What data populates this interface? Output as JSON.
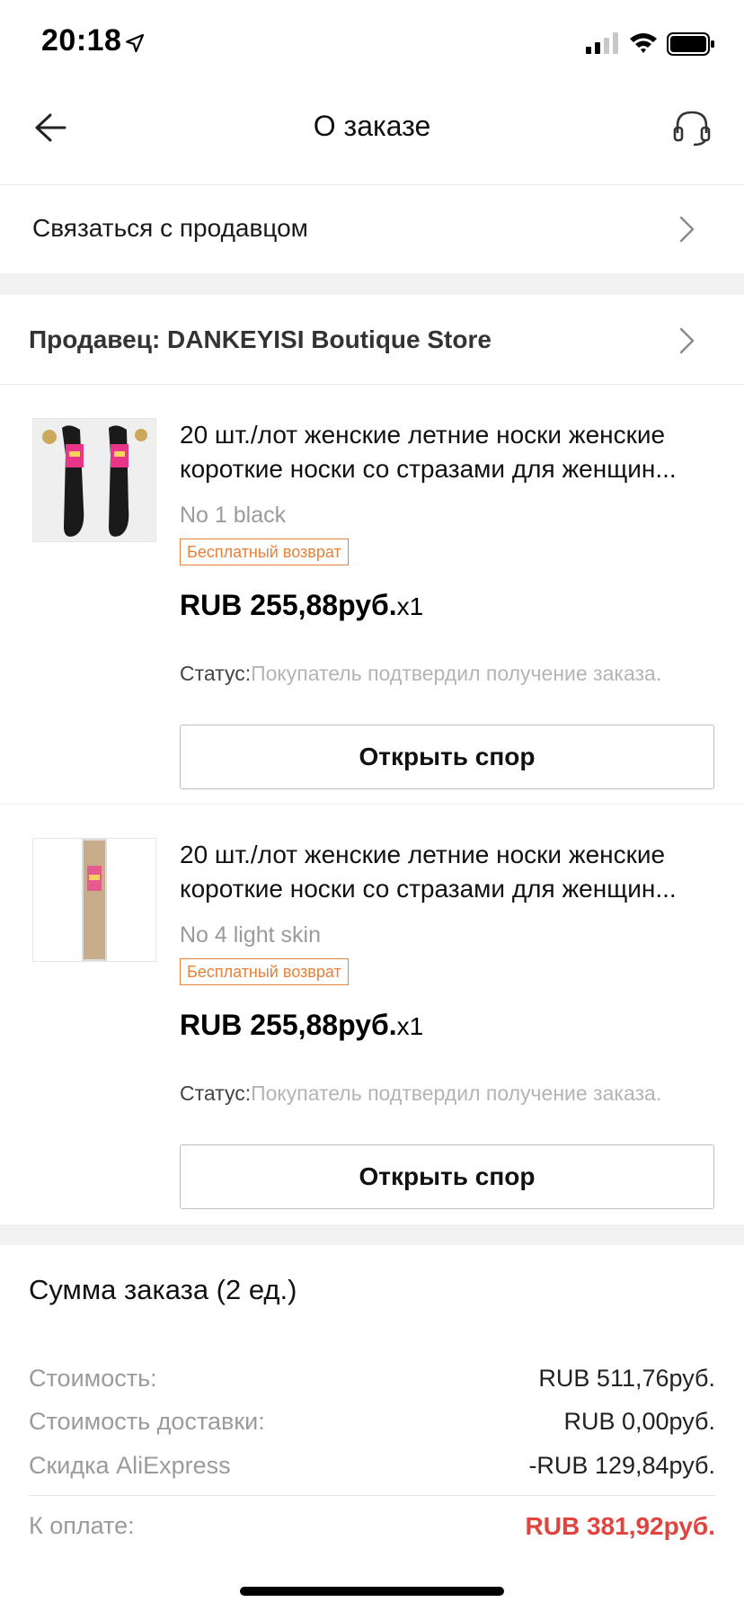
{
  "status_bar": {
    "time": "20:18",
    "icons": [
      "location-arrow-icon",
      "cellular-signal-icon",
      "wifi-icon",
      "battery-icon"
    ]
  },
  "nav": {
    "title": "О заказе",
    "back_icon": "arrow-left-icon",
    "support_icon": "headset-icon"
  },
  "contact_seller": {
    "label": "Связаться с продавцом"
  },
  "seller": {
    "label": "Продавец: DANKEYISI Boutique Store"
  },
  "items": [
    {
      "title_line1": "20 шт./лот женские летние носки женские",
      "title_line2": "короткие носки со стразами для женщин...",
      "variant": "No 1 black",
      "badge": "Бесплатный возврат",
      "price": "RUB 255,88руб.",
      "qty": "x1",
      "status_label": "Статус:",
      "status_value": "Покупатель подтвердил получение заказа.",
      "dispute_label": "Открыть спор"
    },
    {
      "title_line1": "20 шт./лот женские летние носки женские",
      "title_line2": "короткие носки со стразами для женщин...",
      "variant": "No 4 light skin",
      "badge": "Бесплатный возврат",
      "price": "RUB 255,88руб.",
      "qty": "x1",
      "status_label": "Статус:",
      "status_value": "Покупатель подтвердил получение заказа.",
      "dispute_label": "Открыть спор"
    }
  ],
  "summary": {
    "heading": "Сумма заказа (2 ед.)",
    "cost_label": "Стоимость:",
    "cost_value": "RUB 511,76руб.",
    "shipping_label": "Стоимость доставки:",
    "shipping_value": "RUB 0,00руб.",
    "discount_label": "Скидка AliExpress",
    "discount_value": "-RUB 129,84руб.",
    "total_label": "К оплате:",
    "total_value": "RUB 381,92руб."
  },
  "colors": {
    "accent_red": "#e1443e",
    "badge_orange": "#e7813a",
    "divider_gray": "#f2f2f2"
  }
}
